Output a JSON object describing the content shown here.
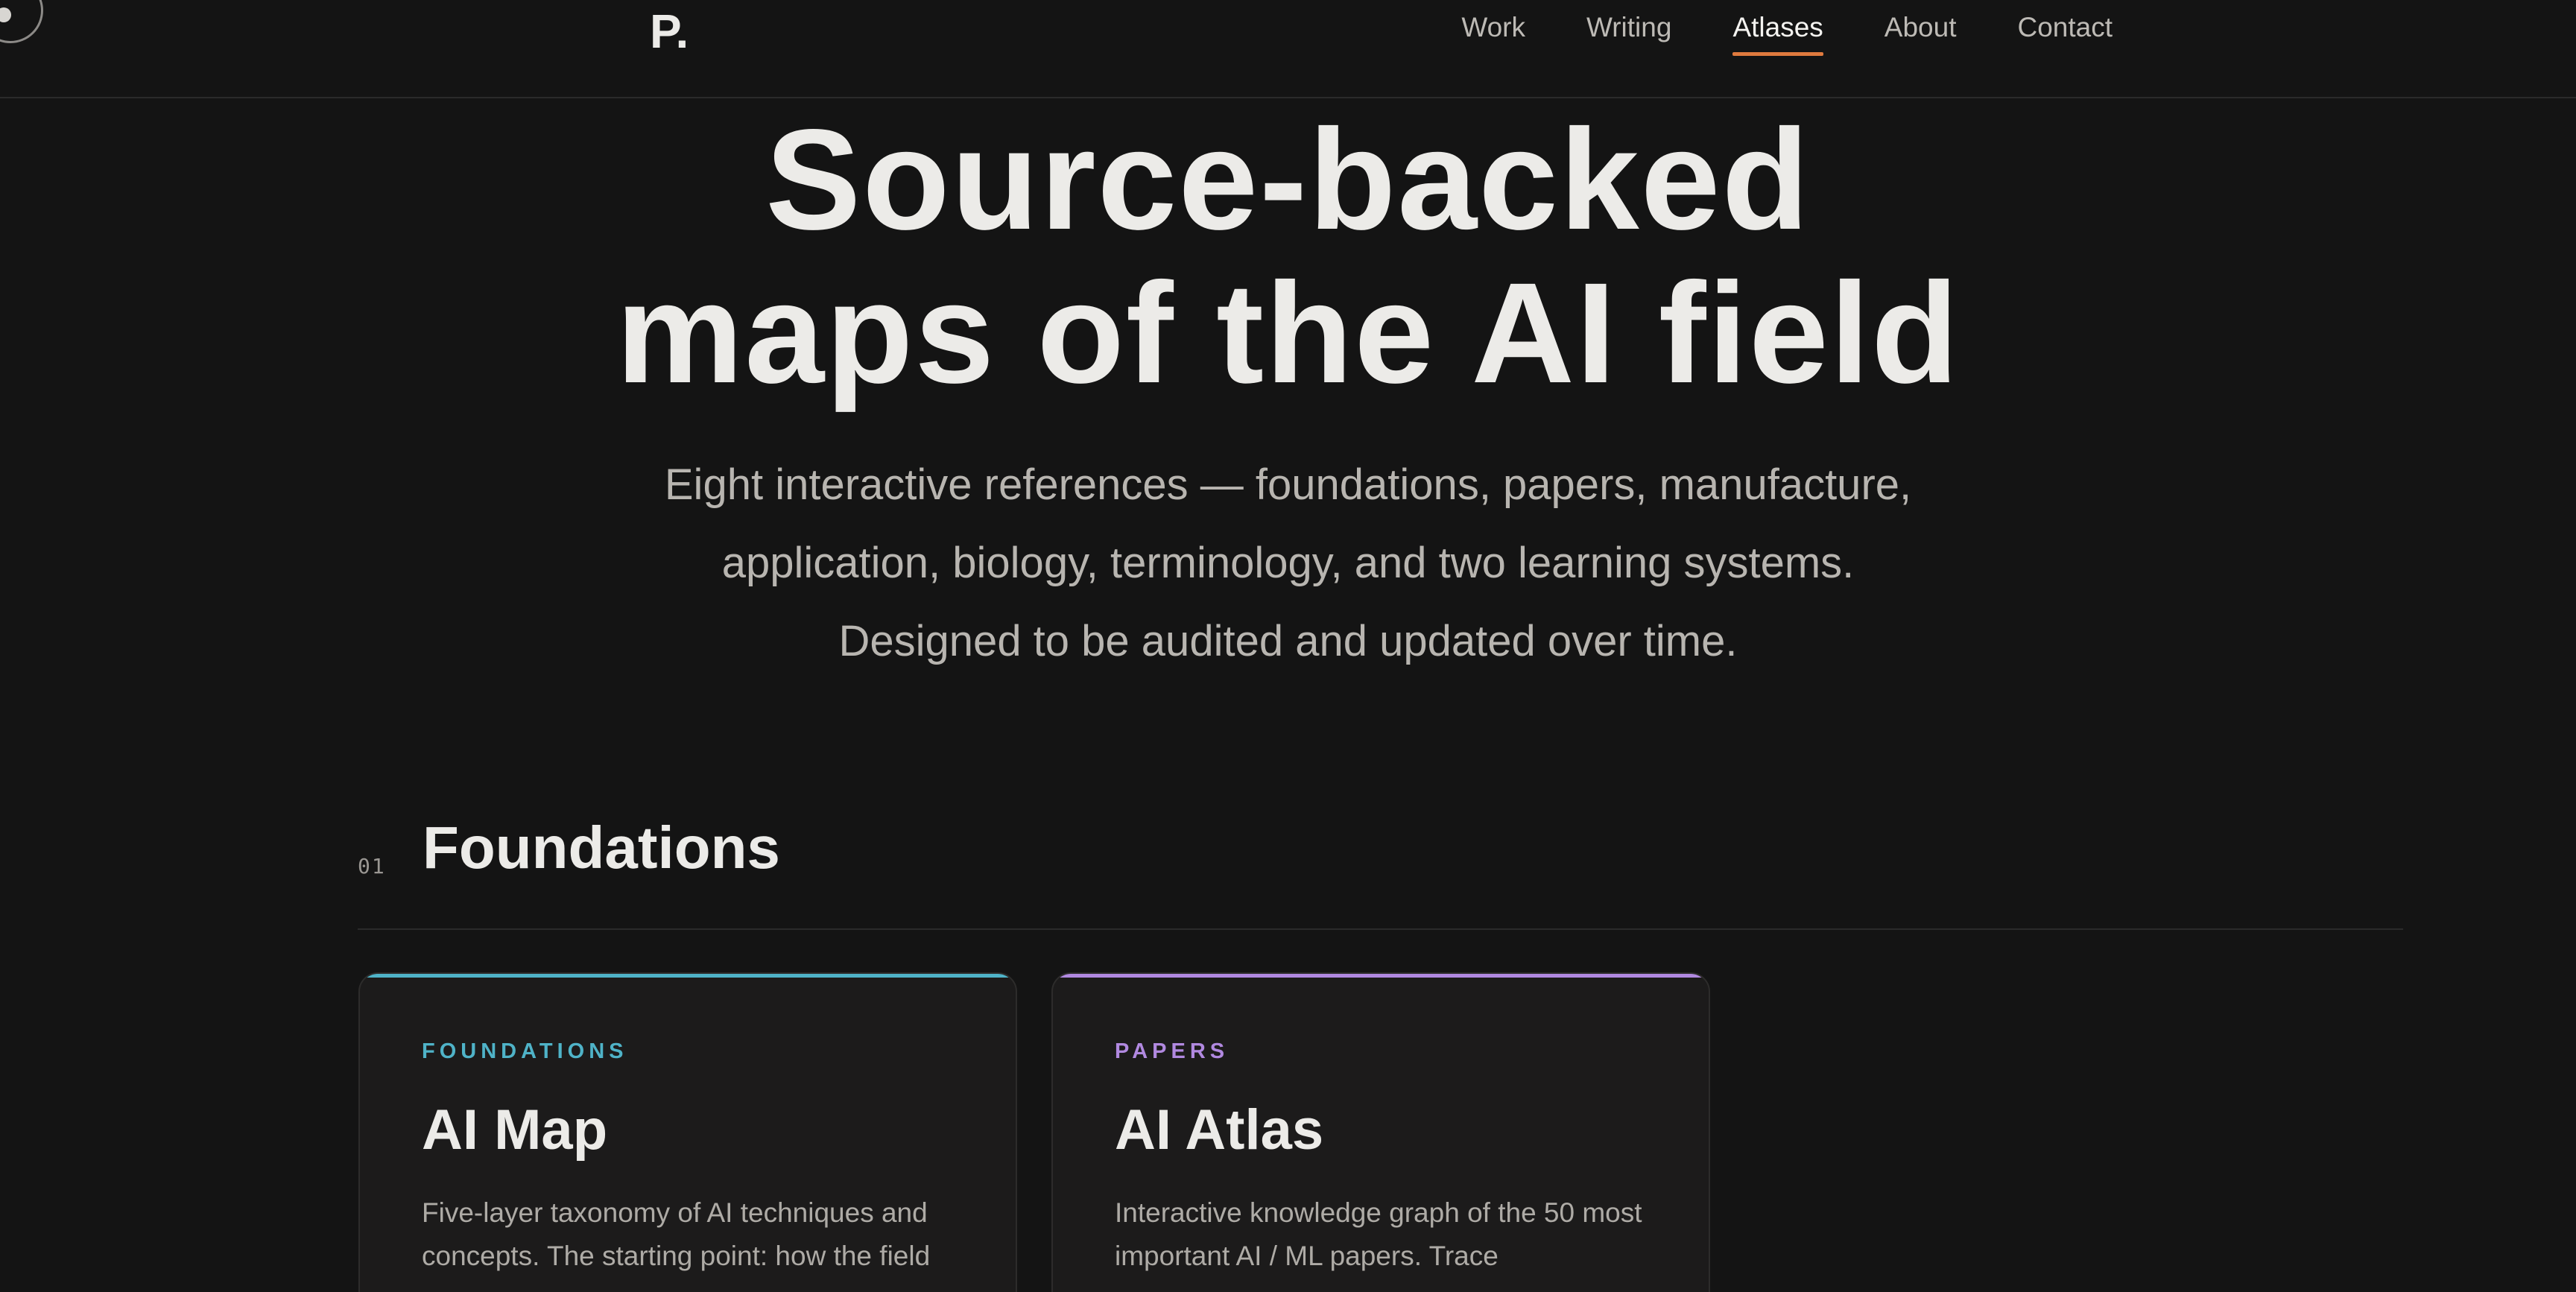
{
  "header": {
    "logo": "P.",
    "nav": [
      {
        "label": "Work",
        "active": false
      },
      {
        "label": "Writing",
        "active": false
      },
      {
        "label": "Atlases",
        "active": true
      },
      {
        "label": "About",
        "active": false
      },
      {
        "label": "Contact",
        "active": false
      }
    ],
    "accent_color": "#e07a3e"
  },
  "hero": {
    "title_line1": "Source-backed",
    "title_line2": "maps of the AI field",
    "subtitle_line1": "Eight interactive references — foundations, papers, manufacture,",
    "subtitle_line2": "application, biology, terminology, and two learning systems.",
    "subtitle_line3": "Designed to be audited and updated over time."
  },
  "section": {
    "number": "01",
    "title": "Foundations"
  },
  "cards": [
    {
      "eyebrow": "FOUNDATIONS",
      "title": "AI Map",
      "description": "Five-layer taxonomy of AI techniques and concepts. The starting point: how the field",
      "accent": "#4fb3c8"
    },
    {
      "eyebrow": "PAPERS",
      "title": "AI Atlas",
      "description": "Interactive knowledge graph of the 50 most important AI / ML papers. Trace",
      "accent": "#b189e0"
    }
  ]
}
